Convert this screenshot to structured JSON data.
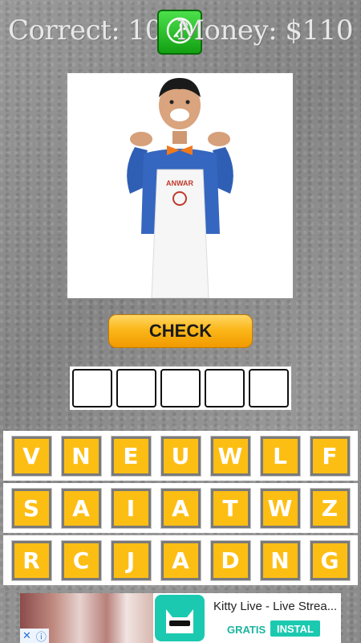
{
  "header": {
    "correct": "Correct: 10/",
    "money": "Money: $110",
    "hint_icon": "key-icon"
  },
  "question": {
    "image_alt": "Man in blue shirt, orange bow tie and white apron",
    "apron_text": "ANWAR"
  },
  "check_label": "CHECK",
  "answer": {
    "slots": 5
  },
  "keyboard": {
    "rows": [
      [
        "V",
        "N",
        "E",
        "U",
        "W",
        "L",
        "F"
      ],
      [
        "S",
        "A",
        "I",
        "A",
        "T",
        "W",
        "Z"
      ],
      [
        "R",
        "C",
        "J",
        "A",
        "D",
        "N",
        "G"
      ]
    ]
  },
  "ad": {
    "title": "Kitty Live - Live Strea...",
    "free": "GRATIS",
    "install": "INSTAL",
    "icons": [
      "close-icon",
      "info-icon"
    ]
  },
  "colors": {
    "key": "#fdbe14",
    "check": "#fbb71a",
    "hint": "#2bc22b"
  }
}
